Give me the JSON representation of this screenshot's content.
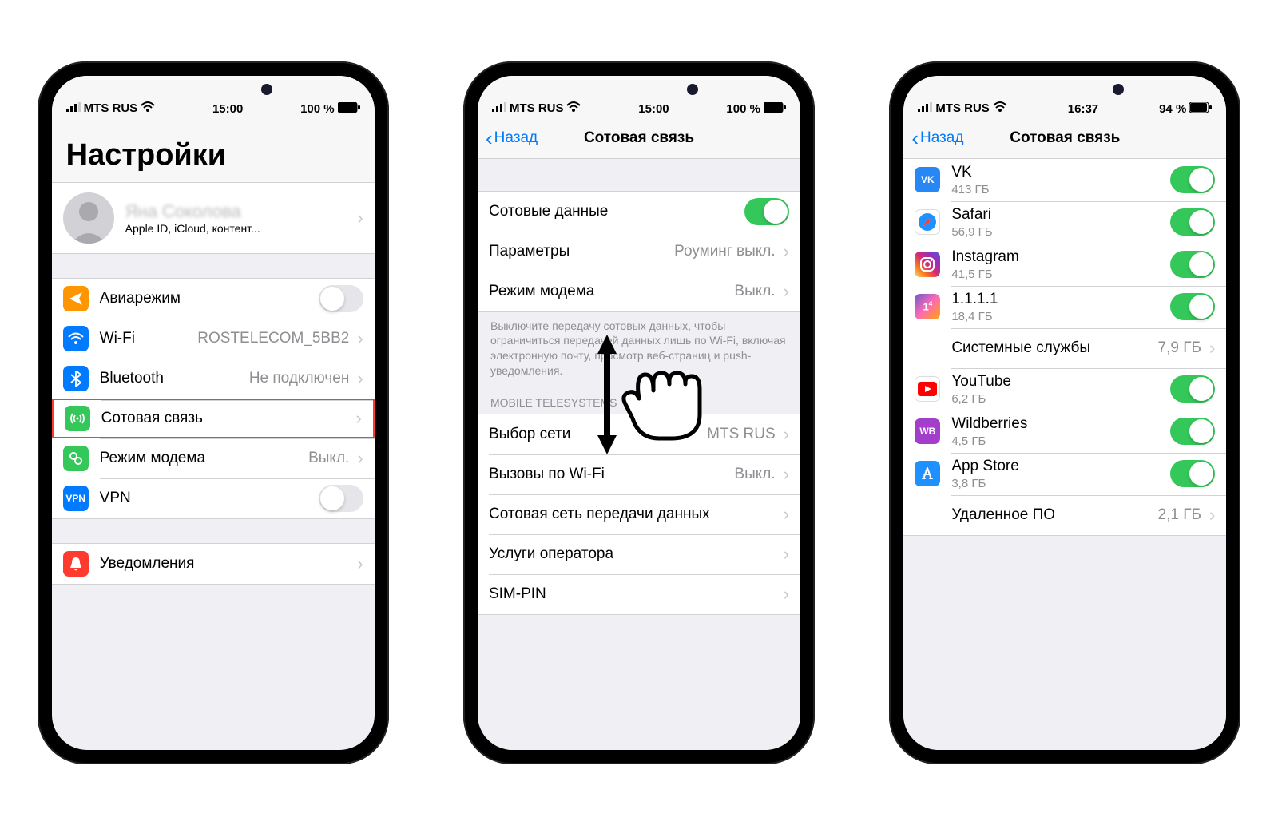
{
  "phone1": {
    "status": {
      "carrier": "MTS RUS",
      "time": "15:00",
      "battery": "100 %"
    },
    "title": "Настройки",
    "profile": {
      "name": "Яна Соколова",
      "sub": "Apple ID, iCloud, контент..."
    },
    "rows": {
      "airplane": "Авиарежим",
      "wifi": "Wi-Fi",
      "wifi_val": "ROSTELECOM_5BB2",
      "bluetooth": "Bluetooth",
      "bluetooth_val": "Не подключен",
      "cellular": "Сотовая связь",
      "hotspot": "Режим модема",
      "hotspot_val": "Выкл.",
      "vpn": "VPN",
      "notifications": "Уведомления"
    }
  },
  "phone2": {
    "status": {
      "carrier": "MTS RUS",
      "time": "15:00",
      "battery": "100 %"
    },
    "back": "Назад",
    "title": "Сотовая связь",
    "rows": {
      "cellular_data": "Сотовые данные",
      "options": "Параметры",
      "options_val": "Роуминг выкл.",
      "hotspot": "Режим модема",
      "hotspot_val": "Выкл.",
      "footer": "Выключите передачу сотовых данных, чтобы ограничиться передачей данных лишь по Wi-Fi, включая электронную почту, просмотр веб-страниц и push-уведомления.",
      "section": "MOBILE TELESYSTEMS",
      "network": "Выбор сети",
      "network_val": "MTS RUS",
      "wifi_calling": "Вызовы по Wi-Fi",
      "wifi_calling_val": "Выкл.",
      "cdn": "Сотовая сеть передачи данных",
      "carrier_svc": "Услуги оператора",
      "simpin": "SIM-PIN"
    }
  },
  "phone3": {
    "status": {
      "carrier": "MTS RUS",
      "time": "16:37",
      "battery": "94 %"
    },
    "back": "Назад",
    "title": "Сотовая связь",
    "apps": [
      {
        "name": "VK",
        "size": "413 ГБ",
        "color": "#2787f5",
        "glyph": "VK"
      },
      {
        "name": "Safari",
        "size": "56,9 ГБ",
        "color": "#fff",
        "glyph": "safari"
      },
      {
        "name": "Instagram",
        "size": "41,5 ГБ",
        "color": "ig",
        "glyph": "ig"
      },
      {
        "name": "1.1.1.1",
        "size": "18,4 ГБ",
        "color": "1111",
        "glyph": "1"
      },
      {
        "name": "YouTube",
        "size": "6,2 ГБ",
        "color": "#fff",
        "glyph": "yt"
      },
      {
        "name": "Wildberries",
        "size": "4,5 ГБ",
        "color": "#a23ec9",
        "glyph": "WB"
      },
      {
        "name": "App Store",
        "size": "3,8 ГБ",
        "color": "#1e90ff",
        "glyph": "A"
      }
    ],
    "system_services": "Системные службы",
    "system_services_val": "7,9 ГБ",
    "removed_sw": "Удаленное ПО",
    "removed_sw_val": "2,1 ГБ"
  }
}
